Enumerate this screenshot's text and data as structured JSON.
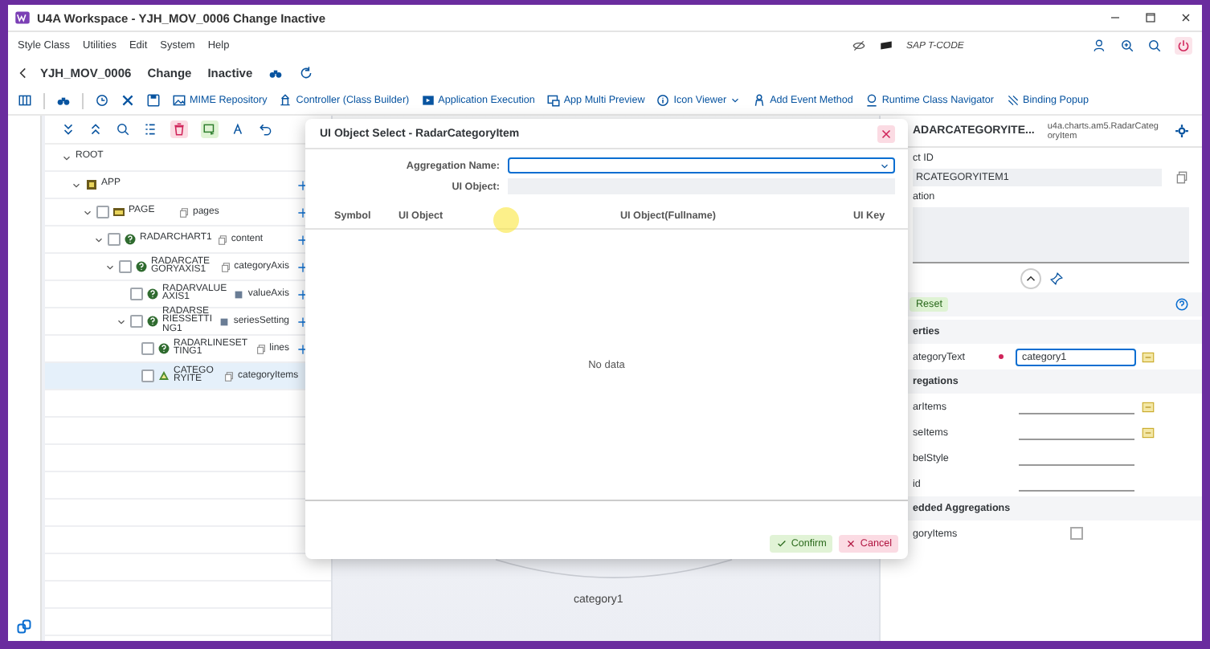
{
  "window": {
    "title": "U4A Workspace - YJH_MOV_0006 Change Inactive"
  },
  "menu": [
    "Style Class",
    "Utilities",
    "Edit",
    "System",
    "Help"
  ],
  "tcode": {
    "placeholder": "SAP T-CODE"
  },
  "header": {
    "app_id": "YJH_MOV_0006",
    "mode": "Change",
    "status": "Inactive"
  },
  "toolbar": [
    {
      "label": "MIME Repository",
      "kind": "button"
    },
    {
      "label": "Controller (Class Builder)",
      "kind": "button"
    },
    {
      "label": "Application Execution",
      "kind": "button"
    },
    {
      "label": "App Multi Preview",
      "kind": "button"
    },
    {
      "label": "Icon Viewer",
      "kind": "dropdown"
    },
    {
      "label": "Add Event Method",
      "kind": "button"
    },
    {
      "label": "Runtime Class Navigator",
      "kind": "button"
    },
    {
      "label": "Binding Popup",
      "kind": "button"
    }
  ],
  "tree": {
    "root": "ROOT",
    "expanded": true,
    "children": [
      {
        "name": "APP",
        "kind": "app",
        "expanded": true,
        "selected": false,
        "children": [
          {
            "name": "PAGE",
            "kind": "page",
            "aggregation": "pages",
            "expanded": true,
            "selected": false,
            "children": [
              {
                "name": "RADARCHART1",
                "kind": "control",
                "aggregation": "content",
                "expanded": true,
                "selected": false,
                "children": [
                  {
                    "name": "RADARCATEGORYAXIS1",
                    "kind": "control",
                    "aggregation": "categoryAxis",
                    "expanded": true,
                    "selected": false,
                    "children": [
                      {
                        "name": "RADARVALUEAXIS1",
                        "kind": "control",
                        "aggregation": "valueAxis",
                        "single": true,
                        "selected": false
                      },
                      {
                        "name": "RADARSERIESSETTING1",
                        "kind": "control",
                        "aggregation": "seriesSetting",
                        "single": true,
                        "expanded": true,
                        "selected": false,
                        "children": [
                          {
                            "name": "RADARLINESETTING1",
                            "kind": "control",
                            "aggregation": "lines",
                            "selected": false
                          },
                          {
                            "name": "CATEGORYITE",
                            "kind": "item",
                            "aggregation": "categoryItems",
                            "selected": true
                          }
                        ]
                      }
                    ]
                  }
                ]
              }
            ]
          }
        ]
      }
    ]
  },
  "canvas": {
    "label": "category1"
  },
  "dialog": {
    "title": "UI Object Select - RadarCategoryItem",
    "fields": [
      {
        "label": "Aggregation Name:",
        "kind": "select"
      },
      {
        "label": "UI Object:",
        "kind": "readonly"
      }
    ],
    "columns": [
      "Symbol",
      "UI Object",
      "UI Object(Fullname)",
      "UI Key"
    ],
    "empty_text": "No data",
    "buttons": [
      {
        "label": "Confirm",
        "kind": "confirm"
      },
      {
        "label": "Cancel",
        "kind": "cancel"
      }
    ]
  },
  "properties": {
    "title": "ADARCATEGORYITE...",
    "class_name": "u4a.charts.am5.RadarCategoryItem",
    "id_label": "ct ID",
    "id_value": "RCATEGORYITEM1",
    "description_label": "ation",
    "reset": "Reset",
    "sections": [
      {
        "title": "erties",
        "rows": [
          {
            "name": "ategoryText",
            "kind": "input",
            "required": true,
            "value": "category1",
            "bind": true
          }
        ]
      },
      {
        "title": "regations",
        "rows": [
          {
            "name": "arItems",
            "kind": "line",
            "bind": true
          },
          {
            "name": "seItems",
            "kind": "line",
            "bind": true
          },
          {
            "name": "belStyle",
            "kind": "line",
            "bind": false
          },
          {
            "name": "id",
            "kind": "line",
            "bind": false
          }
        ]
      },
      {
        "title": "edded Aggregations",
        "rows": [
          {
            "name": "goryItems",
            "kind": "checkbox",
            "checked": false
          }
        ]
      }
    ]
  }
}
